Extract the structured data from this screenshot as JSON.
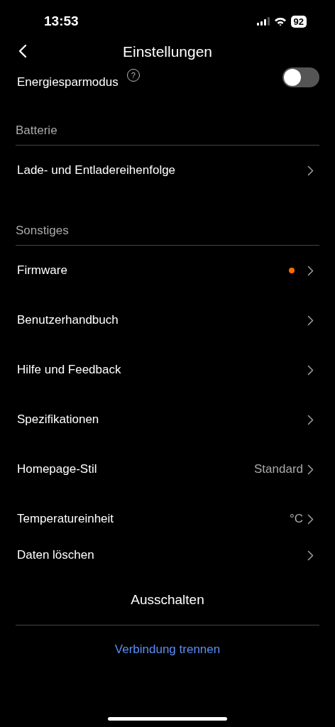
{
  "status_bar": {
    "time": "13:53",
    "battery": "92"
  },
  "header": {
    "title": "Einstellungen"
  },
  "top_setting": {
    "label": "Energiesparmodus",
    "help": "?",
    "on": false
  },
  "sections": [
    {
      "title": "Batterie",
      "items": [
        {
          "label": "Lade- und Entladereihenfolge",
          "dot": false
        }
      ]
    },
    {
      "title": "Sonstiges",
      "items": [
        {
          "label": "Firmware",
          "dot": true
        },
        {
          "label": "Benutzerhandbuch",
          "dot": false
        },
        {
          "label": "Hilfe und Feedback",
          "dot": false
        },
        {
          "label": "Spezifikationen",
          "dot": false
        },
        {
          "label": "Homepage-Stil",
          "value": "Standard",
          "dot": false
        },
        {
          "label": "Temperatureinheit",
          "value": "°C",
          "dot": false
        },
        {
          "label": "Daten löschen",
          "dot": false
        }
      ]
    }
  ],
  "power_off": "Ausschalten",
  "disconnect": "Verbindung trennen"
}
